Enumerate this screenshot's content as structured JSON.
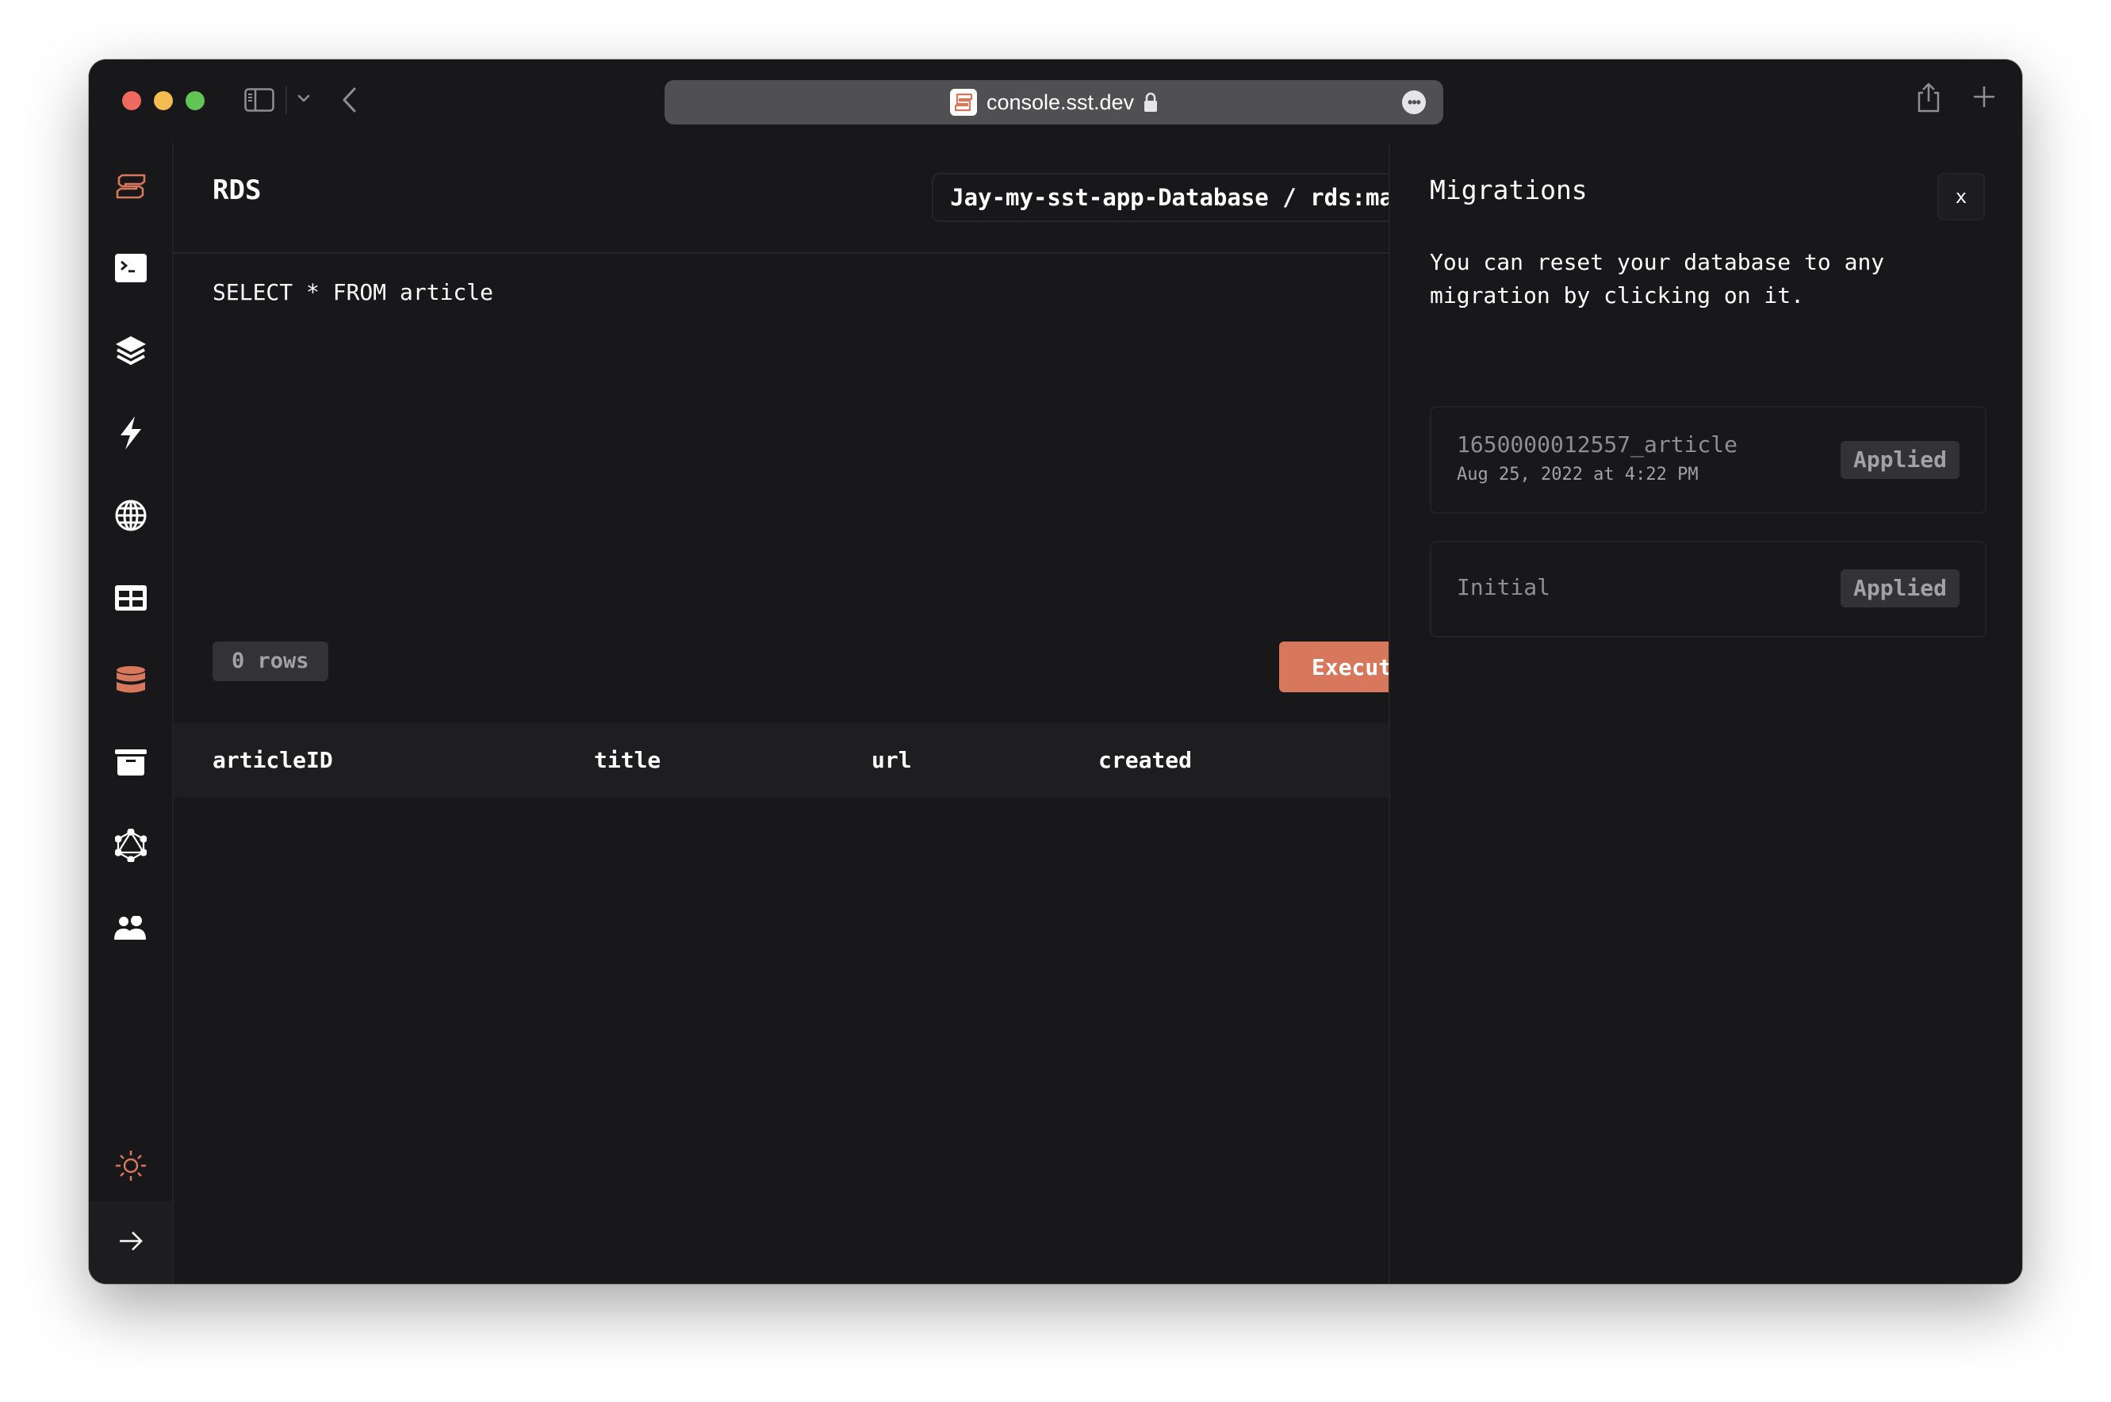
{
  "browser": {
    "url": "console.sst.dev",
    "icons": {
      "sidebar_toggle": "sidebar-toggle-icon",
      "tab_chevron": "chevron-down-icon",
      "back": "chevron-left-icon",
      "lock": "lock-icon",
      "more": "ellipsis-icon",
      "share": "share-icon",
      "new_tab": "plus-icon"
    }
  },
  "sidebar": {
    "items": [
      {
        "id": "sst-logo",
        "icon": "sst-logo-icon",
        "active": true
      },
      {
        "id": "local",
        "icon": "terminal-icon"
      },
      {
        "id": "stacks",
        "icon": "layers-icon"
      },
      {
        "id": "functions",
        "icon": "lightning-icon"
      },
      {
        "id": "api",
        "icon": "globe-icon"
      },
      {
        "id": "dynamodb",
        "icon": "table-icon"
      },
      {
        "id": "rds",
        "icon": "database-icon",
        "active": true
      },
      {
        "id": "buckets",
        "icon": "archive-icon"
      },
      {
        "id": "graphql",
        "icon": "graphql-icon"
      },
      {
        "id": "cognito",
        "icon": "users-icon"
      }
    ],
    "theme_toggle": "sun-icon",
    "expand": "arrow-right-icon"
  },
  "main": {
    "title": "RDS",
    "db_selector": "Jay-my-sst-app-Database / rds:main",
    "query": "SELECT * FROM article",
    "rows_count": "0 rows",
    "execute_label": "Execute",
    "columns": [
      "articleID",
      "title",
      "url",
      "created"
    ],
    "rows": []
  },
  "migrations": {
    "title": "Migrations",
    "close_label": "x",
    "description": "You can reset your database to any migration by clicking on it.",
    "items": [
      {
        "name": "1650000012557_article",
        "date": "Aug 25, 2022 at 4:22 PM",
        "status": "Applied"
      },
      {
        "name": "Initial",
        "date": "",
        "status": "Applied"
      }
    ]
  },
  "colors": {
    "accent": "#d7775b",
    "background": "#18181b",
    "badge_bg": "#333335"
  }
}
